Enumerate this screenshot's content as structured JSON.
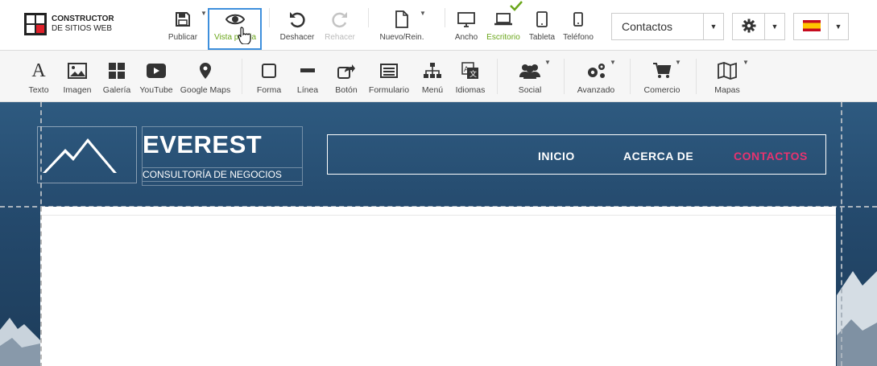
{
  "brand": {
    "line1": "CONSTRUCTOR",
    "line2": "DE SITIOS WEB"
  },
  "top": {
    "publish": "Publicar",
    "preview": "Vista previa",
    "undo": "Deshacer",
    "redo": "Rehacer",
    "new_reset": "Nuevo/Rein.",
    "wide": "Ancho",
    "desktop": "Escritorio",
    "tablet": "Tableta",
    "phone": "Teléfono",
    "page_select": "Contactos"
  },
  "tools": {
    "text": "Texto",
    "image": "Imagen",
    "gallery": "Galería",
    "youtube": "YouTube",
    "maps": "Google Maps",
    "shape": "Forma",
    "line": "Línea",
    "button": "Botón",
    "form": "Formulario",
    "menu": "Menú",
    "languages": "Idiomas",
    "social": "Social",
    "advanced": "Avanzado",
    "commerce": "Comercio",
    "maps2": "Mapas"
  },
  "site": {
    "title": "EVEREST",
    "subtitle": "CONSULTORÍA DE NEGOCIOS",
    "nav": [
      "INICIO",
      "ACERCA DE",
      "CONTACTOS"
    ]
  },
  "colors": {
    "accent": "#6aa61a",
    "nav_active": "#e8336f",
    "selection": "#3e8fdc"
  }
}
